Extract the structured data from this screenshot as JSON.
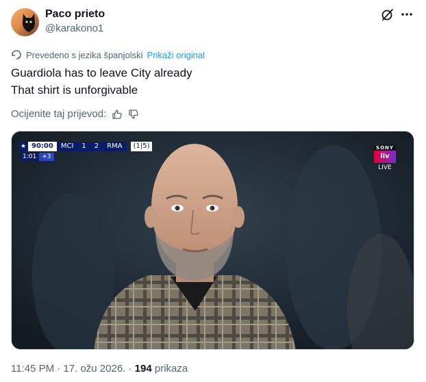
{
  "author": {
    "display_name": "Paco prieto",
    "handle": "@karakono1"
  },
  "translation": {
    "note": "Prevedeno s jezika španjolski",
    "show_original_label": "Prikaži original"
  },
  "tweet": {
    "lines": [
      "Guardiola has to leave City already",
      "That shirt is unforgivable"
    ]
  },
  "rating": {
    "prompt": "Ocijenite taj prijevod:"
  },
  "media": {
    "scoreboard": {
      "time": "90:00",
      "home": "MCI",
      "home_score": "1",
      "away_score": "2",
      "away": "RMA",
      "aggregate": "(1|5)",
      "added_time": "1:01",
      "added_plus": "+3"
    },
    "broadcaster": {
      "brand": "SONY",
      "channel": "liv",
      "live_label": "LIVE"
    }
  },
  "footer": {
    "time_date": "11:45 PM · 17. ožu 2026. · ",
    "views_count": "194",
    "views_label": " prikaza"
  },
  "icons": {
    "grok": "grok-icon",
    "more": "more-icon",
    "translate": "translate-icon",
    "thumbs_up": "thumbs-up-icon",
    "thumbs_down": "thumbs-down-icon"
  }
}
